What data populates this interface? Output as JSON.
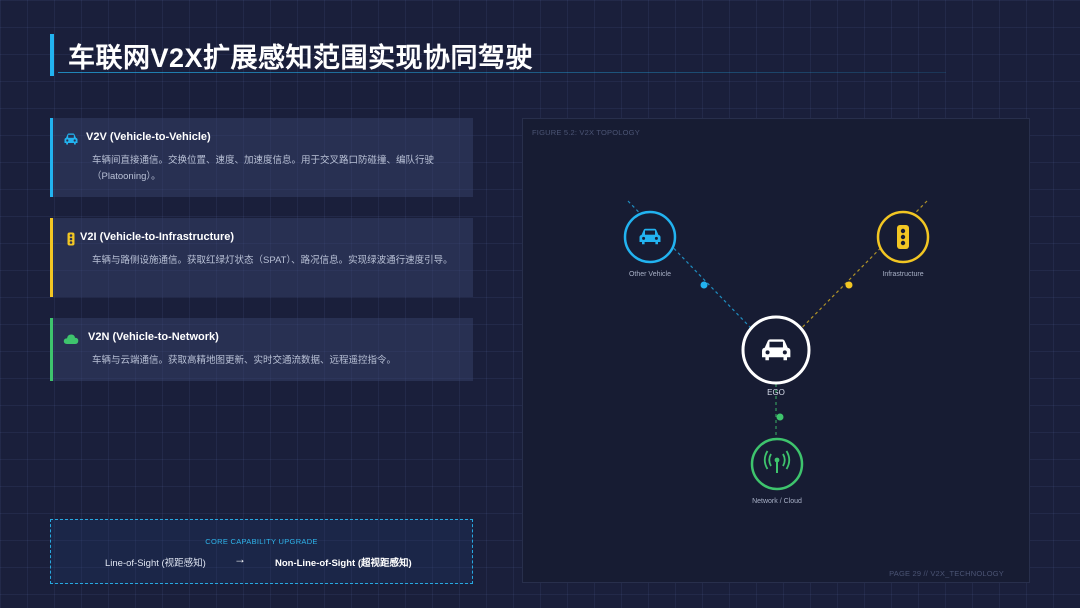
{
  "title": "车联网V2X扩展感知范围实现协同驾驶",
  "cards": [
    {
      "heading": "V2V (Vehicle-to-Vehicle)",
      "description": "车辆间直接通信。交换位置、速度、加速度信息。用于交叉路口防碰撞、编队行驶（Platooning）。",
      "icon": "car-icon",
      "color": "#22b3f0"
    },
    {
      "heading": "V2I (Vehicle-to-Infrastructure)",
      "description": "车辆与路侧设施通信。获取红绿灯状态（SPAT）、路况信息。实现绿波通行速度引导。",
      "icon": "traffic-light-icon",
      "color": "#f2c623"
    },
    {
      "heading": "V2N (Vehicle-to-Network)",
      "description": "车辆与云端通信。获取高精地图更新、实时交通流数据、远程遥控指令。",
      "icon": "cloud-icon",
      "color": "#3ec46d"
    }
  ],
  "upgrade": {
    "caption": "CORE CAPABILITY UPGRADE",
    "from": "Line-of-Sight (视距感知)",
    "arrow": "→",
    "to": "Non-Line-of-Sight (超视距感知)"
  },
  "figure": {
    "label": "FIGURE 5.2: V2X TOPOLOGY",
    "page": "PAGE 29 // V2X_TECHNOLOGY",
    "nodes": {
      "ego": {
        "label": "EGO",
        "icon": "car-icon",
        "color": "#ffffff"
      },
      "vehicle": {
        "label": "Other Vehicle",
        "icon": "car-icon",
        "color": "#22b3f0"
      },
      "infra": {
        "label": "Infrastructure",
        "icon": "traffic-light-icon",
        "color": "#f2c623"
      },
      "network": {
        "label": "Network / Cloud",
        "icon": "antenna-icon",
        "color": "#3ec46d"
      }
    }
  }
}
